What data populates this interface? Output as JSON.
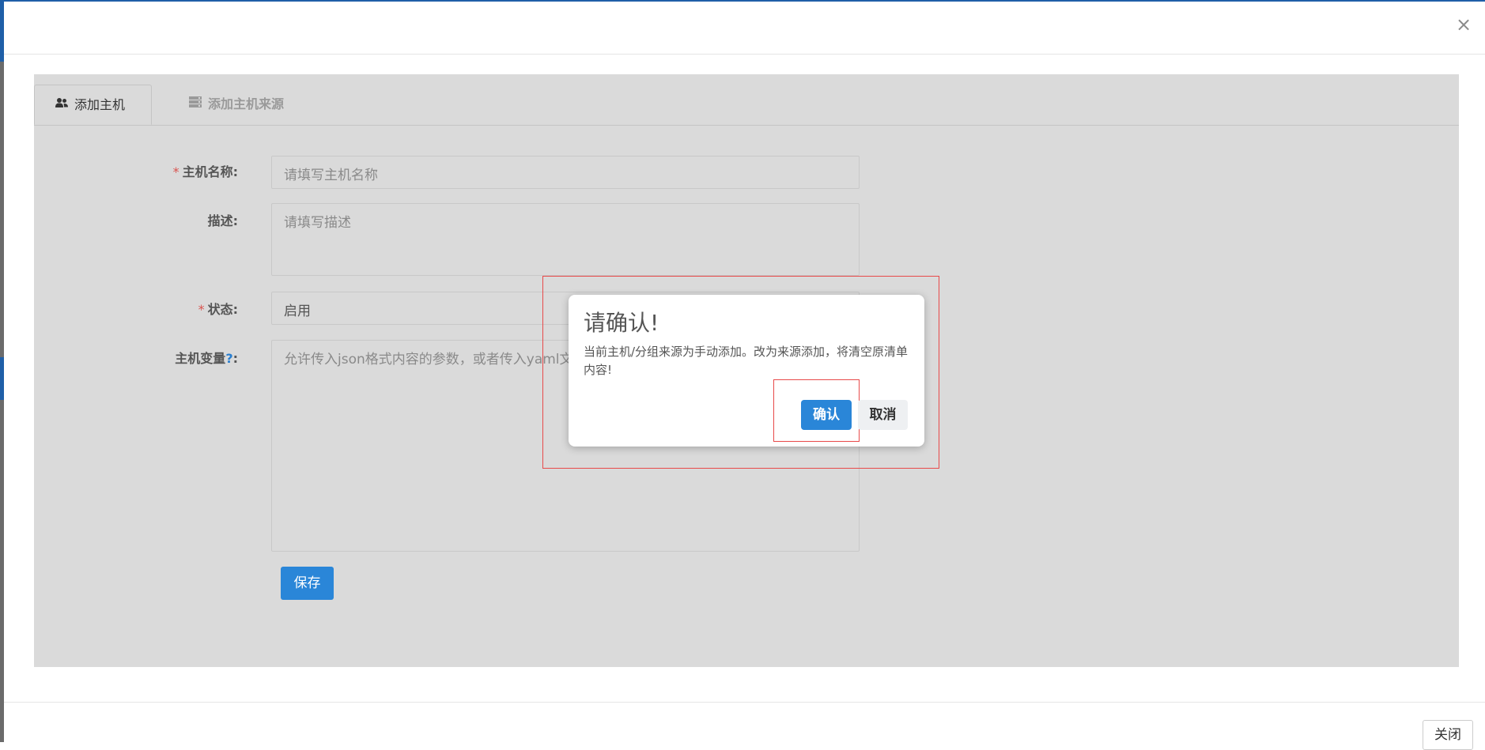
{
  "modal": {
    "close_icon": "×",
    "footer_close_label": "关闭"
  },
  "tabs": [
    {
      "label": "添加主机",
      "icon": "users-icon",
      "active": true
    },
    {
      "label": "添加主机来源",
      "icon": "server-icon",
      "active": false
    }
  ],
  "form": {
    "host_name_label": "主机名称:",
    "host_name_placeholder": "请填写主机名称",
    "description_label": "描述:",
    "description_placeholder": "请填写描述",
    "status_label": "状态:",
    "status_value": "启用",
    "host_vars_label": "主机变量",
    "host_vars_help": "?",
    "host_vars_colon": ":",
    "host_vars_placeholder": "允许传入json格式内容的参数，或者传入yaml文",
    "required_mark": "*",
    "save_label": "保存"
  },
  "dialog": {
    "title": "请确认!",
    "message": "当前主机/分组来源为手动添加。改为来源添加，将清空原清单内容!",
    "confirm_label": "确认",
    "cancel_label": "取消"
  },
  "colors": {
    "primary": "#2a86d8",
    "required": "#d9534f",
    "highlight_outline": "#e84a4a",
    "panel_bg": "#dadada"
  }
}
